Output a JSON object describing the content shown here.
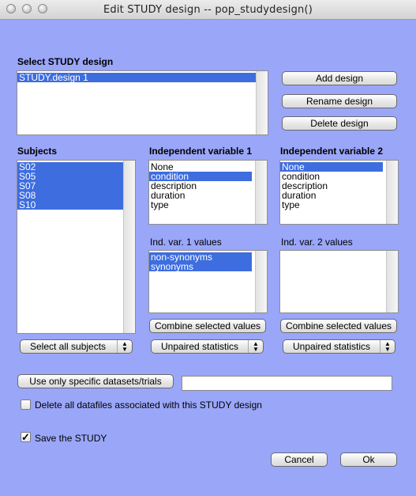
{
  "window": {
    "title": "Edit STUDY design -- pop_studydesign()"
  },
  "design": {
    "label": "Select STUDY design",
    "items": [
      "STUDY.design 1"
    ],
    "add_label": "Add design",
    "rename_label": "Rename design",
    "delete_label": "Delete design"
  },
  "subjects": {
    "label": "Subjects",
    "items": [
      "S02",
      "S05",
      "S07",
      "S08",
      "S10"
    ],
    "select_all_label": "Select all subjects"
  },
  "var1": {
    "label": "Independent variable 1",
    "items": [
      "None",
      "condition",
      "description",
      "duration",
      "type"
    ],
    "selected": "condition",
    "values_label": "Ind. var. 1 values",
    "values": [
      "non-synonyms",
      "synonyms"
    ],
    "combine_label": "Combine selected values",
    "stats_label": "Unpaired statistics"
  },
  "var2": {
    "label": "Independent variable 2",
    "items": [
      "None",
      "condition",
      "description",
      "duration",
      "type"
    ],
    "selected": "None",
    "values_label": "Ind. var. 2 values",
    "values": [],
    "combine_label": "Combine selected values",
    "stats_label": "Unpaired statistics"
  },
  "datasets": {
    "button_label": "Use only specific datasets/trials",
    "value": ""
  },
  "delete_files": {
    "label": "Delete all datafiles associated with this STUDY design",
    "checked": false
  },
  "save_study": {
    "label": "Save the STUDY",
    "checked": true
  },
  "footer": {
    "cancel_label": "Cancel",
    "ok_label": "Ok"
  },
  "icons": {
    "close": "close-icon",
    "minimize": "minimize-icon",
    "zoom": "zoom-icon",
    "popup": "chevron-updown-icon",
    "check": "checkmark-icon"
  }
}
